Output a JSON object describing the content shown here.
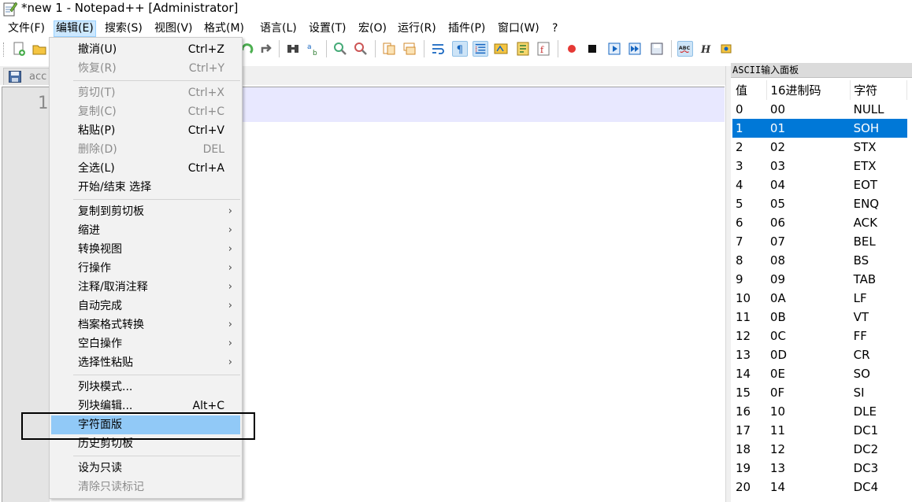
{
  "window": {
    "title": "*new  1 - Notepad++ [Administrator]"
  },
  "menubar": [
    {
      "label": "文件(F)",
      "hot": "F"
    },
    {
      "label": "编辑(E)",
      "hot": "E"
    },
    {
      "label": "搜索(S)",
      "hot": "S"
    },
    {
      "label": "视图(V)",
      "hot": "V"
    },
    {
      "label": "格式(M)",
      "hot": "M"
    },
    {
      "label": "语言(L)",
      "hot": "L"
    },
    {
      "label": "设置(T)",
      "hot": "T"
    },
    {
      "label": "宏(O)",
      "hot": "O"
    },
    {
      "label": "运行(R)",
      "hot": "R"
    },
    {
      "label": "插件(P)",
      "hot": "P"
    },
    {
      "label": "窗口(W)",
      "hot": "W"
    },
    {
      "label": "?",
      "hot": "?"
    }
  ],
  "tab": {
    "label": "acc"
  },
  "editor": {
    "line_number": "1"
  },
  "edit_menu": {
    "items": [
      {
        "label": "撤消(U)",
        "shortcut": "Ctrl+Z",
        "disabled": false
      },
      {
        "label": "恢复(R)",
        "shortcut": "Ctrl+Y",
        "disabled": true
      },
      {
        "label": "剪切(T)",
        "shortcut": "Ctrl+X",
        "disabled": true
      },
      {
        "label": "复制(C)",
        "shortcut": "Ctrl+C",
        "disabled": true
      },
      {
        "label": "粘贴(P)",
        "shortcut": "Ctrl+V",
        "disabled": false
      },
      {
        "label": "删除(D)",
        "shortcut": "DEL",
        "disabled": true
      },
      {
        "label": "全选(L)",
        "shortcut": "Ctrl+A",
        "disabled": false
      },
      {
        "label": "开始/结束 选择",
        "shortcut": "",
        "disabled": false
      },
      {
        "label": "复制到剪切板",
        "submenu": true
      },
      {
        "label": "缩进",
        "submenu": true
      },
      {
        "label": "转换视图",
        "submenu": true
      },
      {
        "label": "行操作",
        "submenu": true
      },
      {
        "label": "注释/取消注释",
        "submenu": true
      },
      {
        "label": "自动完成",
        "submenu": true
      },
      {
        "label": "档案格式转换",
        "submenu": true
      },
      {
        "label": "空白操作",
        "submenu": true
      },
      {
        "label": "选择性粘贴",
        "submenu": true
      },
      {
        "label": "列块模式...",
        "shortcut": "",
        "disabled": false
      },
      {
        "label": "列块编辑...",
        "shortcut": "Alt+C",
        "disabled": false
      },
      {
        "label": "字符面版",
        "shortcut": "",
        "disabled": false,
        "hovered": true
      },
      {
        "label": "历史剪切板",
        "shortcut": "",
        "disabled": false
      },
      {
        "label": "设为只读",
        "shortcut": "",
        "disabled": false
      },
      {
        "label": "清除只读标记",
        "shortcut": "",
        "disabled": true
      }
    ],
    "submenu_arrow": "›"
  },
  "ascii_panel": {
    "title": "ASCII输入面板",
    "headers": [
      "值",
      "16进制码",
      "字符"
    ],
    "rows": [
      [
        "0",
        "00",
        "NULL"
      ],
      [
        "1",
        "01",
        "SOH"
      ],
      [
        "2",
        "02",
        "STX"
      ],
      [
        "3",
        "03",
        "ETX"
      ],
      [
        "4",
        "04",
        "EOT"
      ],
      [
        "5",
        "05",
        "ENQ"
      ],
      [
        "6",
        "06",
        "ACK"
      ],
      [
        "7",
        "07",
        "BEL"
      ],
      [
        "8",
        "08",
        "BS"
      ],
      [
        "9",
        "09",
        "TAB"
      ],
      [
        "10",
        "0A",
        "LF"
      ],
      [
        "11",
        "0B",
        "VT"
      ],
      [
        "12",
        "0C",
        "FF"
      ],
      [
        "13",
        "0D",
        "CR"
      ],
      [
        "14",
        "0E",
        "SO"
      ],
      [
        "15",
        "0F",
        "SI"
      ],
      [
        "16",
        "10",
        "DLE"
      ],
      [
        "17",
        "11",
        "DC1"
      ],
      [
        "18",
        "12",
        "DC2"
      ],
      [
        "19",
        "13",
        "DC3"
      ],
      [
        "20",
        "14",
        "DC4"
      ]
    ],
    "selected_row": 1
  },
  "colors": {
    "selection_blue": "#0078d7",
    "menu_hover": "#91c9f7",
    "current_line": "#e8e8ff"
  }
}
